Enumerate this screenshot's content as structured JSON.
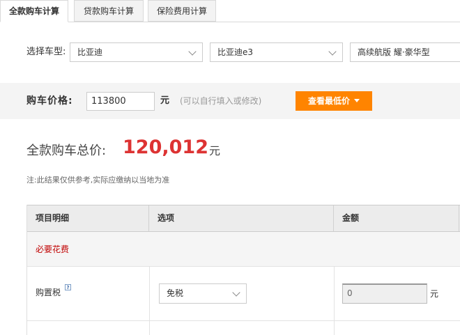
{
  "tabs": [
    {
      "label": "全款购车计算",
      "active": true
    },
    {
      "label": "贷款购车计算",
      "active": false
    },
    {
      "label": "保险费用计算",
      "active": false
    }
  ],
  "model": {
    "label": "选择车型:",
    "brand": "比亚迪",
    "series": "比亚迪e3",
    "trim": "高续航版 耀·豪华型"
  },
  "price": {
    "label": "购车价格:",
    "value": "113800",
    "unit": "元",
    "hint": "(可以自行填入或修改)",
    "best_button": "查看最低价"
  },
  "total": {
    "label": "全款购车总价:",
    "value": "120,012",
    "unit": "元"
  },
  "note": "注:此结果仅供参考,实际应缴纳以当地为准",
  "table": {
    "headers": [
      "项目明细",
      "选项",
      "金额"
    ],
    "section": "必要花费",
    "rows": [
      {
        "item": "购置税",
        "help": "?",
        "option": "免税",
        "amount": "0",
        "unit": "元"
      }
    ]
  },
  "colors": {
    "accent_orange": "#ff8400",
    "total_red": "#dd3333",
    "section_red": "#c00000"
  }
}
